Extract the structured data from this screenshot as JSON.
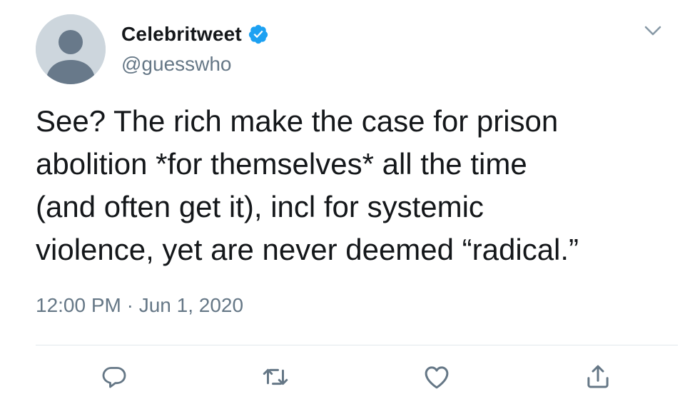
{
  "tweet": {
    "author": {
      "display_name": "Celebritweet",
      "handle": "@guesswho",
      "verified": true
    },
    "text_lines": [
      "See? The rich make the case for prison",
      "abolition *for themselves* all the time",
      "(and often get it), incl for systemic",
      "violence, yet are never deemed “radical.”"
    ],
    "timestamp": "12:00 PM · Jun 1, 2020",
    "actions": [
      "reply-icon",
      "retweet-icon",
      "like-icon",
      "share-icon"
    ]
  },
  "colors": {
    "text": "#14171a",
    "secondary_text": "#657786",
    "verified_blue": "#1da1f2",
    "action_icon": "#657786",
    "divider": "#e1e8ed",
    "avatar_bg": "#cdd6dd",
    "avatar_fg": "#7b8a96"
  }
}
